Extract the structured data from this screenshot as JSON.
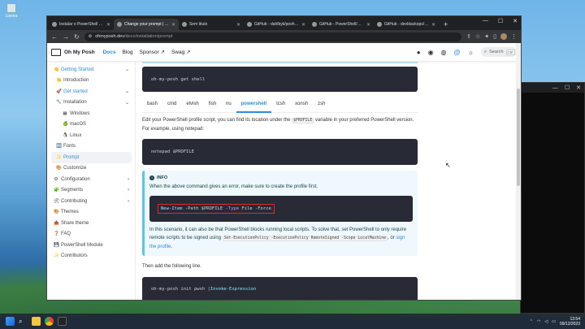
{
  "desktop": {
    "icon_label": "Lixeira"
  },
  "browser": {
    "tabs": [
      {
        "label": "Instalar o PowerShell no Wi",
        "active": false
      },
      {
        "label": "Change your prompt | Oh M",
        "active": true
      },
      {
        "label": "Sem titulo",
        "active": false
      },
      {
        "label": "GitHub - dahlbyk/posh-git:",
        "active": false
      },
      {
        "label": "GitHub - PowerShell/PSRea",
        "active": false
      },
      {
        "label": "GitHub - devblackops/Terr",
        "active": false
      }
    ],
    "new_tab": "+",
    "url_host": "ohmyposh.dev",
    "url_path": "/docs/installation/prompt",
    "window_controls": [
      "—",
      "☐",
      "✕"
    ]
  },
  "site": {
    "brand": "Oh My Posh",
    "nav": [
      {
        "label": "Docs",
        "active": true
      },
      {
        "label": "Blog",
        "active": false
      },
      {
        "label": "Sponsor ↗",
        "active": false
      },
      {
        "label": "Swag ↗",
        "active": false
      }
    ],
    "search_placeholder": "Search",
    "search_kbd": [
      "Ctrl",
      "K"
    ]
  },
  "sidebar": [
    {
      "label": "Getting Started",
      "emoji": "👋",
      "level": 0,
      "chevron": "⌄",
      "style": "cat"
    },
    {
      "label": "Introduction",
      "emoji": "👋",
      "level": 1
    },
    {
      "label": "Get started",
      "emoji": "🚀",
      "level": 1,
      "chevron": "⌄",
      "style": "cat"
    },
    {
      "label": "Installation",
      "emoji": "🔧",
      "level": 1,
      "chevron": "⌄"
    },
    {
      "label": "Windows",
      "emoji": "▦",
      "level": 2
    },
    {
      "label": "macOS",
      "emoji": "🍏",
      "level": 2
    },
    {
      "label": "Linux",
      "emoji": "🐧",
      "level": 2
    },
    {
      "label": "Fonts",
      "emoji": "🔤",
      "level": 1
    },
    {
      "label": "Prompt",
      "emoji": "✨",
      "level": 1,
      "style": "cur"
    },
    {
      "label": "Customize",
      "emoji": "🎨",
      "level": 1
    },
    {
      "label": "Configuration",
      "emoji": "⚙",
      "level": 0,
      "chevron": "›"
    },
    {
      "label": "Segments",
      "emoji": "🧩",
      "level": 0,
      "chevron": "›"
    },
    {
      "label": "Contributing",
      "emoji": "🛠",
      "level": 0,
      "chevron": "›"
    },
    {
      "label": "Themes",
      "emoji": "🎨",
      "level": 0
    },
    {
      "label": "Share theme",
      "emoji": "📤",
      "level": 0
    },
    {
      "label": "FAQ",
      "emoji": "❓",
      "level": 0
    },
    {
      "label": "PowerShell Module",
      "emoji": "💾",
      "level": 0
    },
    {
      "label": "Contributors",
      "emoji": "✨",
      "level": 0
    }
  ],
  "content": {
    "code1": "oh-my-posh get shell",
    "shell_tabs": [
      {
        "label": "bash",
        "active": false
      },
      {
        "label": "cmd",
        "active": false
      },
      {
        "label": "elvish",
        "active": false
      },
      {
        "label": "fish",
        "active": false
      },
      {
        "label": "nu",
        "active": false
      },
      {
        "label": "powershell",
        "active": true
      },
      {
        "label": "tcsh",
        "active": false
      },
      {
        "label": "xonsh",
        "active": false
      },
      {
        "label": "zsh",
        "active": false
      }
    ],
    "para1_a": "Edit your PowerShell profile script, you can find its location under the",
    "para1_code": "$PROFILE",
    "para1_b": "variable in your preferred PowerShell version. For example, using notepad:",
    "code2": "notepad $PROFILE",
    "info_title": "INFO",
    "info_text": "When the above command gives an error, make sure to create the profile first.",
    "cmd_kw": "New-Item",
    "cmd_a": " -Path $PROFILE ",
    "cmd_op": "-Type",
    "cmd_b": " File -Force",
    "info_p2_a": "In this scenario, it can also be that PowerShell blocks running local scripts. To solve that, set PowerShell to only require remote scripts to be signed using",
    "info_p2_code1": "Set-ExecutionPolicy -ExecutionPolicy RemoteSigned -Scope LocalMachine",
    "info_p2_b": ", or",
    "info_p2_link": "sign the profile",
    "info_p2_c": ".",
    "para2": "Then add the following line.",
    "code3_a": "oh-my-posh init pwsh | ",
    "code3_kw": "Invoke-Expression"
  },
  "taskbar": {
    "time": "13:54",
    "date": "09/12/2023"
  }
}
